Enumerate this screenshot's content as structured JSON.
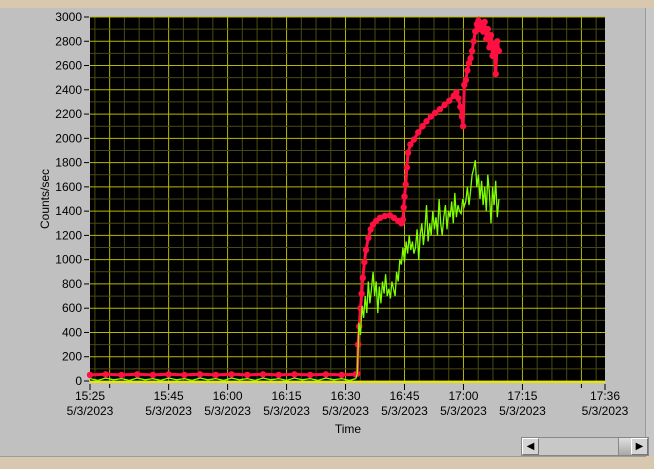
{
  "chart_data": {
    "type": "line",
    "title": "",
    "xlabel": "Time",
    "ylabel": "Counts/sec",
    "x_units": "minutes since 15:25 5/3/2023",
    "xlim": [
      0,
      131
    ],
    "ylim": [
      0,
      3000
    ],
    "grid": true,
    "y_ticks": [
      0,
      200,
      400,
      600,
      800,
      1000,
      1200,
      1400,
      1600,
      1800,
      2000,
      2200,
      2400,
      2600,
      2800,
      3000
    ],
    "x_ticks": [
      {
        "value": 0,
        "time": "15:25",
        "date": "5/3/2023"
      },
      {
        "value": 20,
        "time": "15:45",
        "date": "5/3/2023"
      },
      {
        "value": 35,
        "time": "16:00",
        "date": "5/3/2023"
      },
      {
        "value": 50,
        "time": "16:15",
        "date": "5/3/2023"
      },
      {
        "value": 65,
        "time": "16:30",
        "date": "5/3/2023"
      },
      {
        "value": 80,
        "time": "16:45",
        "date": "5/3/2023"
      },
      {
        "value": 95,
        "time": "17:00",
        "date": "5/3/2023"
      },
      {
        "value": 110,
        "time": "17:15",
        "date": "5/3/2023"
      },
      {
        "value": 131,
        "time": "17:36",
        "date": "5/3/2023"
      }
    ],
    "x_minor_ticks": [
      5,
      125
    ],
    "series": [
      {
        "name": "red",
        "color": "#ff1040",
        "style": "markers",
        "points": [
          [
            0,
            50
          ],
          [
            4,
            55
          ],
          [
            8,
            50
          ],
          [
            12,
            55
          ],
          [
            16,
            50
          ],
          [
            20,
            55
          ],
          [
            24,
            50
          ],
          [
            28,
            55
          ],
          [
            32,
            50
          ],
          [
            36,
            55
          ],
          [
            40,
            50
          ],
          [
            44,
            55
          ],
          [
            48,
            50
          ],
          [
            52,
            55
          ],
          [
            56,
            50
          ],
          [
            60,
            55
          ],
          [
            64,
            50
          ],
          [
            67.6,
            55
          ],
          [
            68,
            60
          ],
          [
            68.2,
            300
          ],
          [
            68.5,
            450
          ],
          [
            68.8,
            600
          ],
          [
            69.1,
            720
          ],
          [
            69.4,
            850
          ],
          [
            69.8,
            980
          ],
          [
            70.2,
            1080
          ],
          [
            70.8,
            1180
          ],
          [
            71.4,
            1250
          ],
          [
            72,
            1290
          ],
          [
            72.8,
            1320
          ],
          [
            73.8,
            1345
          ],
          [
            75,
            1360
          ],
          [
            76.3,
            1365
          ],
          [
            77.3,
            1345
          ],
          [
            78.4,
            1320
          ],
          [
            79.2,
            1300
          ],
          [
            79.6,
            1330
          ],
          [
            79.8,
            1430
          ],
          [
            80,
            1520
          ],
          [
            80.3,
            1620
          ],
          [
            80.6,
            1760
          ],
          [
            80.9,
            1880
          ],
          [
            81.5,
            1950
          ],
          [
            82.4,
            1990
          ],
          [
            83.5,
            2050
          ],
          [
            84.6,
            2100
          ],
          [
            85.6,
            2140
          ],
          [
            86.7,
            2180
          ],
          [
            87.8,
            2210
          ],
          [
            89,
            2240
          ],
          [
            90.2,
            2275
          ],
          [
            91.4,
            2310
          ],
          [
            92.5,
            2350
          ],
          [
            93.2,
            2380
          ],
          [
            93.7,
            2330
          ],
          [
            94.2,
            2260
          ],
          [
            94.6,
            2180
          ],
          [
            94.9,
            2100
          ],
          [
            95.2,
            2440
          ],
          [
            95.6,
            2480
          ],
          [
            96,
            2560
          ],
          [
            96.4,
            2620
          ],
          [
            96.8,
            2660
          ],
          [
            97.2,
            2720
          ],
          [
            97.6,
            2800
          ],
          [
            98,
            2880
          ],
          [
            98.4,
            2940
          ],
          [
            98.8,
            2970
          ],
          [
            99.2,
            2900
          ],
          [
            99.6,
            2950
          ],
          [
            100,
            2880
          ],
          [
            100.4,
            2960
          ],
          [
            100.8,
            2820
          ],
          [
            101.2,
            2900
          ],
          [
            101.6,
            2750
          ],
          [
            102,
            2850
          ],
          [
            102.4,
            2680
          ],
          [
            102.8,
            2780
          ],
          [
            103.2,
            2530
          ],
          [
            103.6,
            2800
          ],
          [
            104,
            2720
          ]
        ]
      },
      {
        "name": "green",
        "color": "#80ff00",
        "style": "line",
        "points": [
          [
            0,
            20
          ],
          [
            2,
            5
          ],
          [
            4,
            25
          ],
          [
            6,
            10
          ],
          [
            8,
            20
          ],
          [
            10,
            5
          ],
          [
            12,
            25
          ],
          [
            14,
            10
          ],
          [
            16,
            20
          ],
          [
            18,
            5
          ],
          [
            20,
            25
          ],
          [
            22,
            10
          ],
          [
            24,
            20
          ],
          [
            26,
            5
          ],
          [
            28,
            25
          ],
          [
            30,
            10
          ],
          [
            32,
            20
          ],
          [
            34,
            5
          ],
          [
            36,
            25
          ],
          [
            38,
            10
          ],
          [
            40,
            20
          ],
          [
            42,
            5
          ],
          [
            44,
            25
          ],
          [
            46,
            10
          ],
          [
            48,
            20
          ],
          [
            50,
            5
          ],
          [
            52,
            25
          ],
          [
            54,
            10
          ],
          [
            56,
            20
          ],
          [
            58,
            5
          ],
          [
            60,
            25
          ],
          [
            62,
            10
          ],
          [
            64,
            20
          ],
          [
            66,
            5
          ],
          [
            67.6,
            20
          ],
          [
            68,
            60
          ],
          [
            68.4,
            480
          ],
          [
            68.8,
            380
          ],
          [
            69.2,
            620
          ],
          [
            69.6,
            520
          ],
          [
            70,
            700
          ],
          [
            70.4,
            560
          ],
          [
            70.8,
            820
          ],
          [
            71.2,
            640
          ],
          [
            71.6,
            760
          ],
          [
            72,
            900
          ],
          [
            72.4,
            700
          ],
          [
            72.8,
            820
          ],
          [
            73.2,
            560
          ],
          [
            73.6,
            780
          ],
          [
            74,
            640
          ],
          [
            74.4,
            820
          ],
          [
            74.8,
            720
          ],
          [
            75.2,
            880
          ],
          [
            75.6,
            700
          ],
          [
            76,
            760
          ],
          [
            76.4,
            680
          ],
          [
            76.8,
            820
          ],
          [
            77.2,
            760
          ],
          [
            77.6,
            700
          ],
          [
            78,
            900
          ],
          [
            78.4,
            820
          ],
          [
            78.8,
            1000
          ],
          [
            79.2,
            960
          ],
          [
            79.6,
            1100
          ],
          [
            80,
            980
          ],
          [
            80.4,
            1150
          ],
          [
            80.8,
            1050
          ],
          [
            81.2,
            1200
          ],
          [
            81.6,
            1080
          ],
          [
            82,
            1150
          ],
          [
            82.4,
            1050
          ],
          [
            82.8,
            1100
          ],
          [
            83.2,
            1250
          ],
          [
            83.6,
            1000
          ],
          [
            84,
            1200
          ],
          [
            84.4,
            1300
          ],
          [
            84.8,
            1120
          ],
          [
            85.2,
            1250
          ],
          [
            85.6,
            1450
          ],
          [
            86,
            1150
          ],
          [
            86.4,
            1300
          ],
          [
            86.8,
            1200
          ],
          [
            87.2,
            1400
          ],
          [
            87.6,
            1250
          ],
          [
            88,
            1350
          ],
          [
            88.4,
            1200
          ],
          [
            88.8,
            1500
          ],
          [
            89.2,
            1300
          ],
          [
            89.6,
            1200
          ],
          [
            90,
            1350
          ],
          [
            90.4,
            1450
          ],
          [
            90.8,
            1250
          ],
          [
            91.2,
            1400
          ],
          [
            91.6,
            1350
          ],
          [
            92,
            1480
          ],
          [
            92.4,
            1300
          ],
          [
            92.8,
            1550
          ],
          [
            93.2,
            1350
          ],
          [
            93.6,
            1450
          ],
          [
            94,
            1400
          ],
          [
            94.4,
            1380
          ],
          [
            94.8,
            1500
          ],
          [
            95.2,
            1440
          ],
          [
            95.6,
            1480
          ],
          [
            96,
            1600
          ],
          [
            96.4,
            1450
          ],
          [
            96.8,
            1560
          ],
          [
            97.2,
            1700
          ],
          [
            97.6,
            1750
          ],
          [
            98,
            1820
          ],
          [
            98.4,
            1600
          ],
          [
            98.8,
            1700
          ],
          [
            99.2,
            1500
          ],
          [
            99.6,
            1650
          ],
          [
            100,
            1450
          ],
          [
            100.4,
            1600
          ],
          [
            100.8,
            1400
          ],
          [
            101.2,
            1700
          ],
          [
            101.6,
            1550
          ],
          [
            102,
            1300
          ],
          [
            102.4,
            1600
          ],
          [
            102.8,
            1450
          ],
          [
            103.2,
            1650
          ],
          [
            103.6,
            1350
          ],
          [
            104,
            1500
          ]
        ]
      }
    ]
  },
  "colors": {
    "plot_bg": "#000000",
    "grid_major": "#b8b800",
    "grid_minor": "#4a4a10",
    "panel": "#c0c0c0"
  },
  "scrollbar": {
    "left_icon": "arrow-left-icon",
    "right_icon": "arrow-right-icon"
  }
}
